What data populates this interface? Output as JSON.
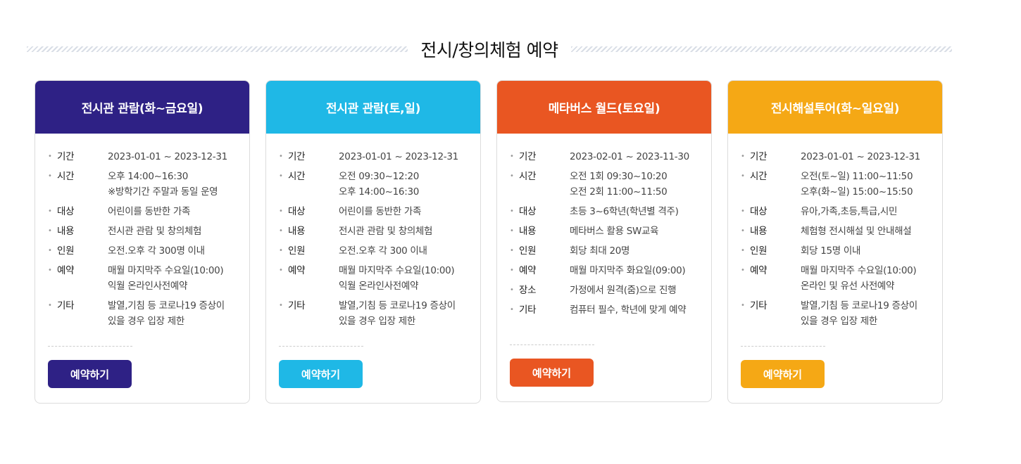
{
  "section": {
    "title": "전시/창의체험 예약"
  },
  "cards": [
    {
      "title": "전시관 관람(화~금요일)",
      "color": "#2e2185",
      "rows": [
        {
          "label": "기간",
          "lines": [
            "2023-01-01 ~ 2023-12-31"
          ]
        },
        {
          "label": "시간",
          "lines": [
            "오후 14:00~16:30",
            "※방학기간 주말과 동일 운영"
          ]
        },
        {
          "label": "대상",
          "lines": [
            "어린이를 동반한 가족"
          ]
        },
        {
          "label": "내용",
          "lines": [
            "전시관 관람 및 창의체험"
          ]
        },
        {
          "label": "인원",
          "lines": [
            "오전.오후 각 300명 이내"
          ]
        },
        {
          "label": "예약",
          "lines": [
            "매월 마지막주 수요일(10:00)",
            "익월 온라인사전예약"
          ]
        },
        {
          "label": "기타",
          "lines": [
            "발열,기침 등 코로나19 증상이",
            "있을 경우 입장 제한"
          ]
        }
      ],
      "button_label": "예약하기"
    },
    {
      "title": "전시관 관람(토,일)",
      "color": "#1fb8e6",
      "rows": [
        {
          "label": "기간",
          "lines": [
            "2023-01-01 ~ 2023-12-31"
          ]
        },
        {
          "label": "시간",
          "lines": [
            "오전 09:30~12:20",
            "오후 14:00~16:30"
          ]
        },
        {
          "label": "대상",
          "lines": [
            "어린이를 동반한 가족"
          ]
        },
        {
          "label": "내용",
          "lines": [
            "전시관 관람 및 창의체험"
          ]
        },
        {
          "label": "인원",
          "lines": [
            "오전.오후 각 300 이내"
          ]
        },
        {
          "label": "예약",
          "lines": [
            "매월 마지막주 수요일(10:00)",
            "익월 온라인사전예약"
          ]
        },
        {
          "label": "기타",
          "lines": [
            "발열,기침 등 코로나19 증상이",
            "있을 경우 입장 제한"
          ]
        }
      ],
      "button_label": "예약하기"
    },
    {
      "title": "메타버스 월드(토요일)",
      "color": "#e95622",
      "rows": [
        {
          "label": "기간",
          "lines": [
            "2023-02-01 ~ 2023-11-30"
          ]
        },
        {
          "label": "시간",
          "lines": [
            "오전 1회 09:30~10:20",
            "오전 2회 11:00~11:50"
          ]
        },
        {
          "label": "대상",
          "lines": [
            "초등 3~6학년(학년별 격주)"
          ]
        },
        {
          "label": "내용",
          "lines": [
            "메타버스 활용 SW교육"
          ]
        },
        {
          "label": "인원",
          "lines": [
            "회당 최대 20명"
          ]
        },
        {
          "label": "예약",
          "lines": [
            "매월 마지막주 화요일(09:00)"
          ]
        },
        {
          "label": "장소",
          "lines": [
            "가정에서 원격(줌)으로 진행"
          ]
        },
        {
          "label": "기타",
          "lines": [
            "컴퓨터 필수, 학년에 맞게 예약"
          ]
        }
      ],
      "button_label": "예약하기"
    },
    {
      "title": "전시해설투어(화~일요일)",
      "color": "#f5a815",
      "rows": [
        {
          "label": "기간",
          "lines": [
            "2023-01-01 ~ 2023-12-31"
          ]
        },
        {
          "label": "시간",
          "lines": [
            "오전(토~일) 11:00~11:50",
            "오후(화~일) 15:00~15:50"
          ]
        },
        {
          "label": "대상",
          "lines": [
            "유아,가족,초등,특급,시민"
          ]
        },
        {
          "label": "내용",
          "lines": [
            "체험형 전시해설 및 안내해설"
          ]
        },
        {
          "label": "인원",
          "lines": [
            "회당 15명 이내"
          ]
        },
        {
          "label": "예약",
          "lines": [
            "매월 마지막주 수요일(10:00)",
            "온라인 및 유선 사전예약"
          ]
        },
        {
          "label": "기타",
          "lines": [
            "발열,기침 등 코로나19 증상이",
            "있을 경우 입장 제한"
          ]
        }
      ],
      "button_label": "예약하기"
    }
  ]
}
